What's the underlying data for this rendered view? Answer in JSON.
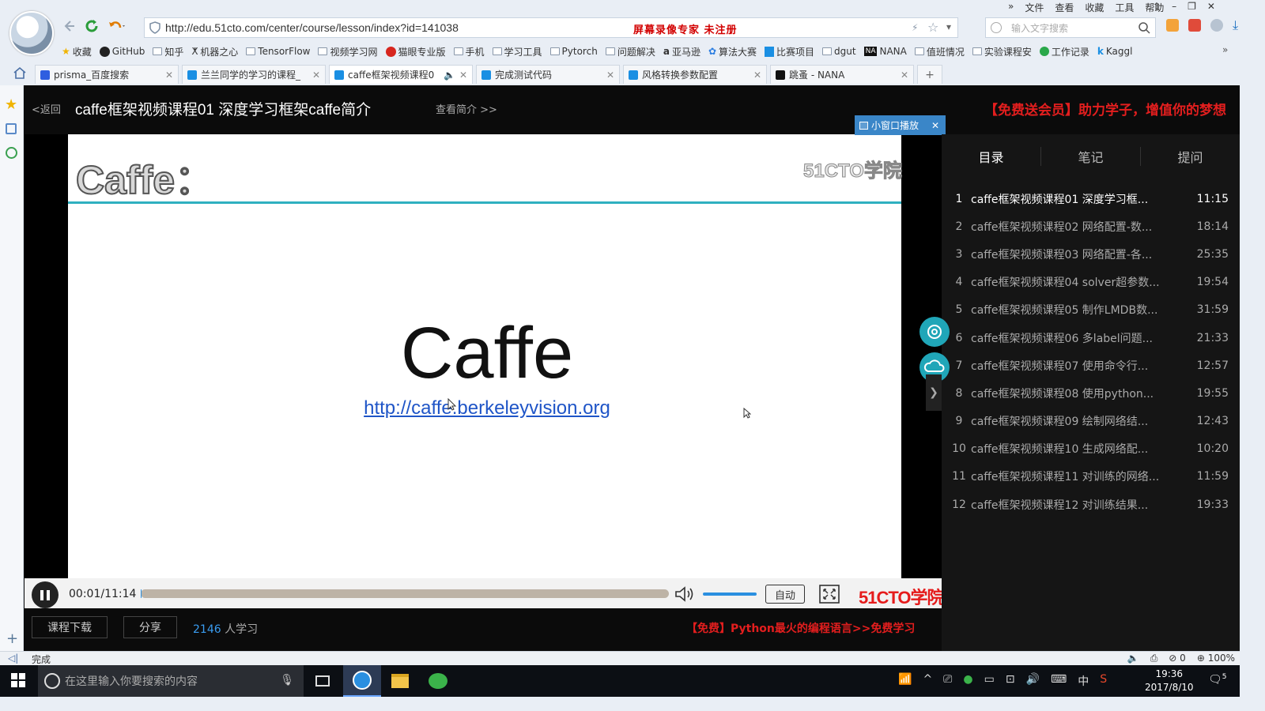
{
  "browser": {
    "url": "http://edu.51cto.com/center/course/lesson/index?id=141038",
    "recorder_notice": "屏幕录像专家  未注册",
    "search_placeholder": "输入文字搜索",
    "menu": [
      "文件",
      "查看",
      "收藏",
      "工具",
      "帮助"
    ],
    "bookmarks": [
      "收藏",
      "GitHub",
      "知乎",
      "机器之心",
      "TensorFlow",
      "视频学习网",
      "猫眼专业版",
      "手机",
      "学习工具",
      "Pytorch",
      "问题解决",
      "亚马逊",
      "算法大赛",
      "比赛项目",
      "dgut",
      "NANA",
      "值班情况",
      "实验课程安",
      "工作记录",
      "Kaggl"
    ],
    "tabs": [
      "prisma_百度搜索",
      "兰兰同学的学习的课程_",
      "caffe框架视频课程0",
      "完成测试代码",
      "风格转换参数配置",
      "跳蚤 - NANA"
    ],
    "status_text": "完成",
    "status_right": [
      "0",
      "100%"
    ]
  },
  "page": {
    "back": "<返回",
    "title": "caffe框架视频课程01 深度学习框架caffe简介",
    "intro_link": "查看简介 >>",
    "promo_top": "【免费送会员】助力学子，增值你的梦想",
    "mini_player": "小窗口播放",
    "slide": {
      "heading": "Caffe：",
      "watermark": "51CTO学院",
      "title": "Caffe",
      "link": "http://caffe.berkeleyvision.org"
    },
    "player": {
      "time": "00:01/11:14",
      "progress": 0.002,
      "volume": 1.0,
      "auto_label": "自动",
      "brand": "51CTO学院"
    },
    "download_btn": "课程下载",
    "share_btn": "分享",
    "learners_count": "2146",
    "learners_suffix": " 人学习",
    "promo_bottom": "【免费】Python最火的编程语言>>免费学习"
  },
  "panel": {
    "tabs": [
      "目录",
      "笔记",
      "提问"
    ],
    "lessons": [
      {
        "n": "1",
        "title": "caffe框架视频课程01 深度学习框...",
        "dur": "11:15"
      },
      {
        "n": "2",
        "title": "caffe框架视频课程02 网络配置-数...",
        "dur": "18:14"
      },
      {
        "n": "3",
        "title": "caffe框架视频课程03 网络配置-各...",
        "dur": "25:35"
      },
      {
        "n": "4",
        "title": "caffe框架视频课程04 solver超参数...",
        "dur": "19:54"
      },
      {
        "n": "5",
        "title": "caffe框架视频课程05 制作LMDB数...",
        "dur": "31:59"
      },
      {
        "n": "6",
        "title": "caffe框架视频课程06 多label问题...",
        "dur": "21:33"
      },
      {
        "n": "7",
        "title": "caffe框架视频课程07 使用命令行...",
        "dur": "12:57"
      },
      {
        "n": "8",
        "title": "caffe框架视频课程08 使用python...",
        "dur": "19:55"
      },
      {
        "n": "9",
        "title": "caffe框架视频课程09 绘制网络结...",
        "dur": "12:43"
      },
      {
        "n": "10",
        "title": "caffe框架视频课程10 生成网络配...",
        "dur": "10:20"
      },
      {
        "n": "11",
        "title": "caffe框架视频课程11 对训练的网络...",
        "dur": "11:59"
      },
      {
        "n": "12",
        "title": "caffe框架视频课程12 对训练结果...",
        "dur": "19:33"
      }
    ]
  },
  "taskbar": {
    "search_placeholder": "在这里输入你要搜索的内容",
    "ime": "中",
    "time": "19:36",
    "date": "2017/8/10",
    "notif": "5"
  }
}
